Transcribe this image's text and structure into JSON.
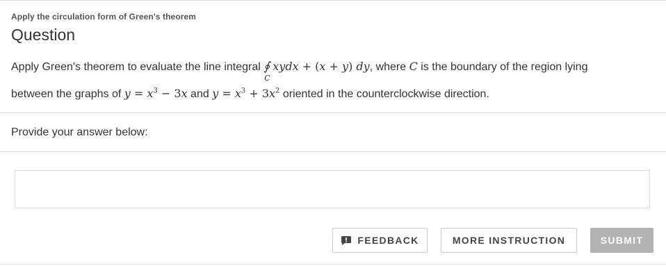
{
  "header": {
    "breadcrumb": "Apply the circulation form of Green's theorem",
    "title": "Question"
  },
  "question": {
    "line1_prefix": "Apply Green's theorem to evaluate the line integral ",
    "integral_sub": "C",
    "integrand_a": "xydx",
    "plus1": " + (",
    "x1": "x",
    "plus2": " + ",
    "y1": "y",
    "close_paren": ") ",
    "dy": "dy",
    "line1_mid": ", where ",
    "curve": "C",
    "line1_suffix": " is the boundary of the region lying",
    "line2_prefix": "between the graphs of ",
    "eq1_y": "y",
    "eq1_eq": " = ",
    "eq1_x": "x",
    "eq1_exp": "3",
    "eq1_rest": " − 3",
    "eq1_x2": "x",
    "and": " and ",
    "eq2_y": "y",
    "eq2_eq": " = ",
    "eq2_x": "x",
    "eq2_exp": "3",
    "eq2_plus": " + 3",
    "eq2_x2": "x",
    "eq2_exp2": "2",
    "line2_suffix": " oriented in the counterclockwise direction."
  },
  "answer": {
    "prompt": "Provide your answer below:",
    "value": ""
  },
  "buttons": {
    "feedback": "FEEDBACK",
    "more_instruction": "MORE INSTRUCTION",
    "submit": "SUBMIT"
  },
  "icons": {
    "feedback_icon": "speech-bubble-exclamation-icon"
  },
  "colors": {
    "submit_bg": "#b3b3b3",
    "text": "#333333",
    "divider": "#dcdcdc"
  }
}
